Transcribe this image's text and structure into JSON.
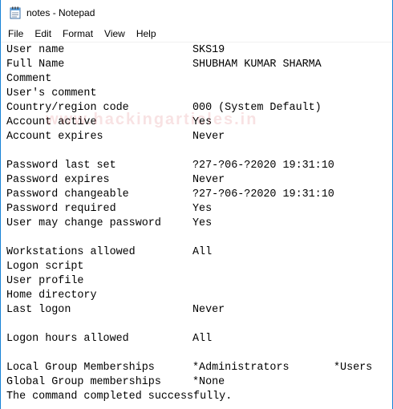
{
  "window": {
    "title": "notes - Notepad",
    "icon": "notepad-icon"
  },
  "menu": [
    "File",
    "Edit",
    "Format",
    "View",
    "Help"
  ],
  "watermark": "www.hackingarticles.in",
  "lines": [
    {
      "label": "User name",
      "value": "SKS19"
    },
    {
      "label": "Full Name",
      "value": "SHUBHAM KUMAR SHARMA"
    },
    {
      "label": "Comment",
      "value": ""
    },
    {
      "label": "User's comment",
      "value": ""
    },
    {
      "label": "Country/region code",
      "value": "000 (System Default)"
    },
    {
      "label": "Account active",
      "value": "Yes"
    },
    {
      "label": "Account expires",
      "value": "Never"
    },
    {
      "label": "",
      "value": ""
    },
    {
      "label": "Password last set",
      "value": "?27-?06-?2020 19:31:10"
    },
    {
      "label": "Password expires",
      "value": "Never"
    },
    {
      "label": "Password changeable",
      "value": "?27-?06-?2020 19:31:10"
    },
    {
      "label": "Password required",
      "value": "Yes"
    },
    {
      "label": "User may change password",
      "value": "Yes"
    },
    {
      "label": "",
      "value": ""
    },
    {
      "label": "Workstations allowed",
      "value": "All"
    },
    {
      "label": "Logon script",
      "value": ""
    },
    {
      "label": "User profile",
      "value": ""
    },
    {
      "label": "Home directory",
      "value": ""
    },
    {
      "label": "Last logon",
      "value": "Never"
    },
    {
      "label": "",
      "value": ""
    },
    {
      "label": "Logon hours allowed",
      "value": "All"
    },
    {
      "label": "",
      "value": ""
    },
    {
      "label": "Local Group Memberships",
      "value": "*Administrators",
      "value2": "*Users"
    },
    {
      "label": "Global Group memberships",
      "value": "*None"
    },
    {
      "label": "The command completed successfully.",
      "value": ""
    }
  ]
}
